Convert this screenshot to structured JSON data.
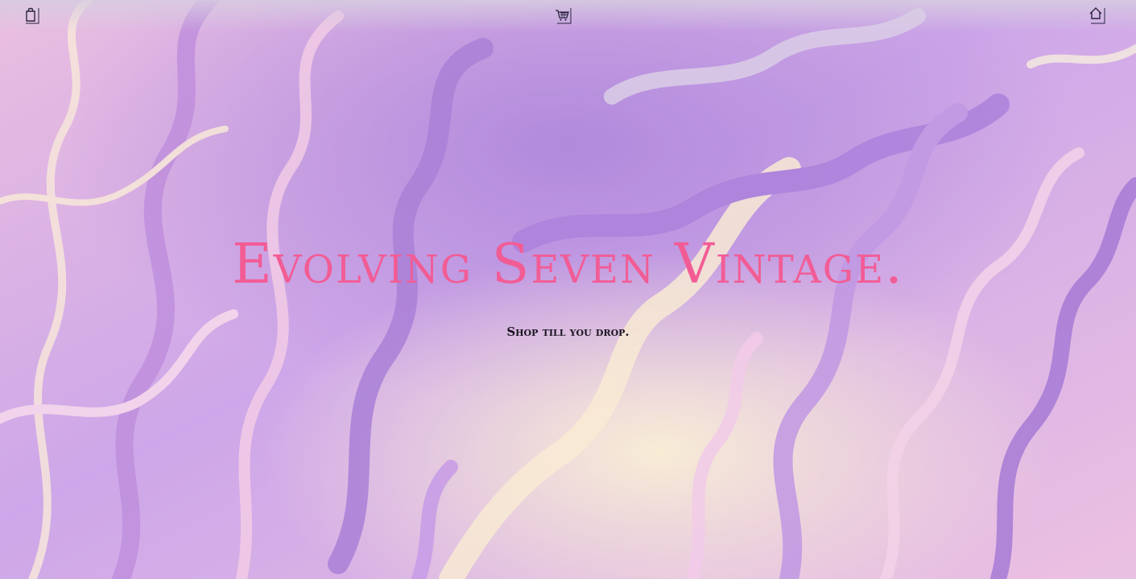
{
  "nav": {
    "left_icon": "shopping-bag-icon",
    "center_icon": "shopping-cart-icon",
    "right_icon": "home-icon"
  },
  "hero": {
    "title": "Evolving Seven Vintage.",
    "subtitle": "Shop till you drop."
  },
  "colors": {
    "title": "#f25c95",
    "subtitle": "#1a1420",
    "background_primary": "#b98ae0",
    "background_secondary": "#f7d6e8",
    "background_highlight": "#f6e7cf"
  }
}
